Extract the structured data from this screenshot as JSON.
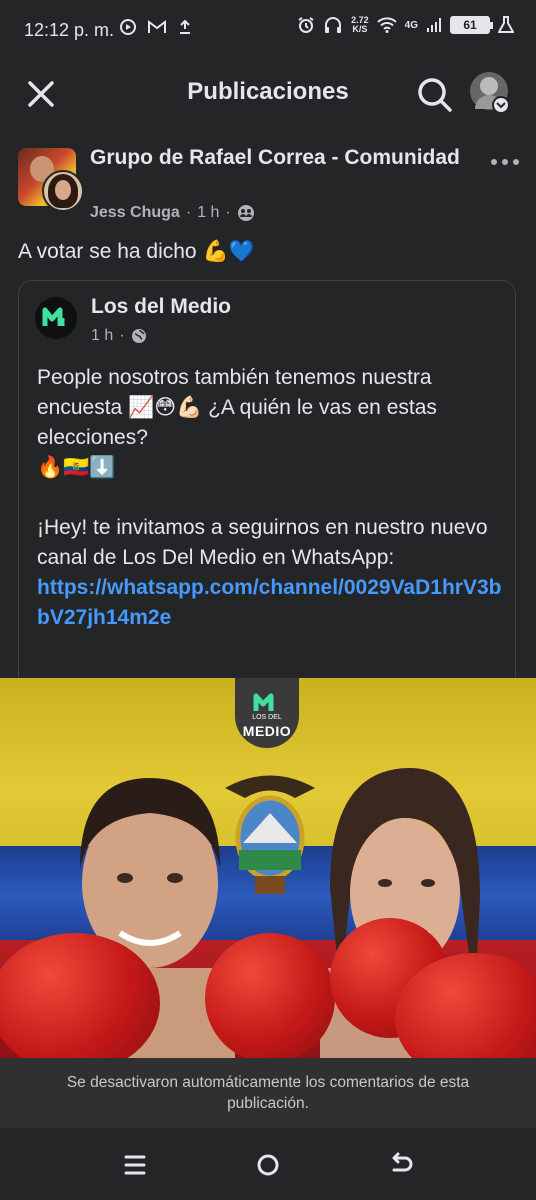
{
  "status_bar": {
    "time": "12:12 p. m.",
    "net_speed_value": "2.72",
    "net_speed_unit": "K/S",
    "network_type": "4G",
    "battery": "61",
    "icons": [
      "youtube-music-icon",
      "gmail-icon",
      "upload-icon",
      "alarm-icon",
      "headphones-icon",
      "wifi-icon",
      "signal-icon",
      "battery-icon",
      "flask-icon"
    ]
  },
  "header": {
    "title": "Publicaciones"
  },
  "post": {
    "group_name": "Grupo de Rafael Correa - Comunidad",
    "author": "Jess Chuga",
    "time": "1 h",
    "separator": "·",
    "text": "A votar se ha dicho 💪💙",
    "shared": {
      "page_name": "Los del Medio",
      "time": "1 h",
      "separator": "·",
      "line1": "People nosotros también tenemos nuestra encuesta 📈😳💪🏻 ¿A quién le vas en estas elecciones?",
      "line2": "🔥🇪🇨⬇️",
      "line3": "¡Hey! te invitamos a seguirnos en nuestro nuevo canal de Los Del Medio en WhatsApp:",
      "link": "https://whatsapp.com/channel/0029VaD1hrV3bbV27jh14m2e"
    },
    "image": {
      "logo_line1": "LOS DEL",
      "logo_line2": "MEDIO"
    },
    "comments_notice": "Se desactivaron automáticamente los comentarios de esta publicación."
  },
  "colors": {
    "background": "#242526",
    "text": "#e4e6eb",
    "muted": "#b0b3b8",
    "link": "#4599ff",
    "brand_green": "#3fe0a0"
  }
}
